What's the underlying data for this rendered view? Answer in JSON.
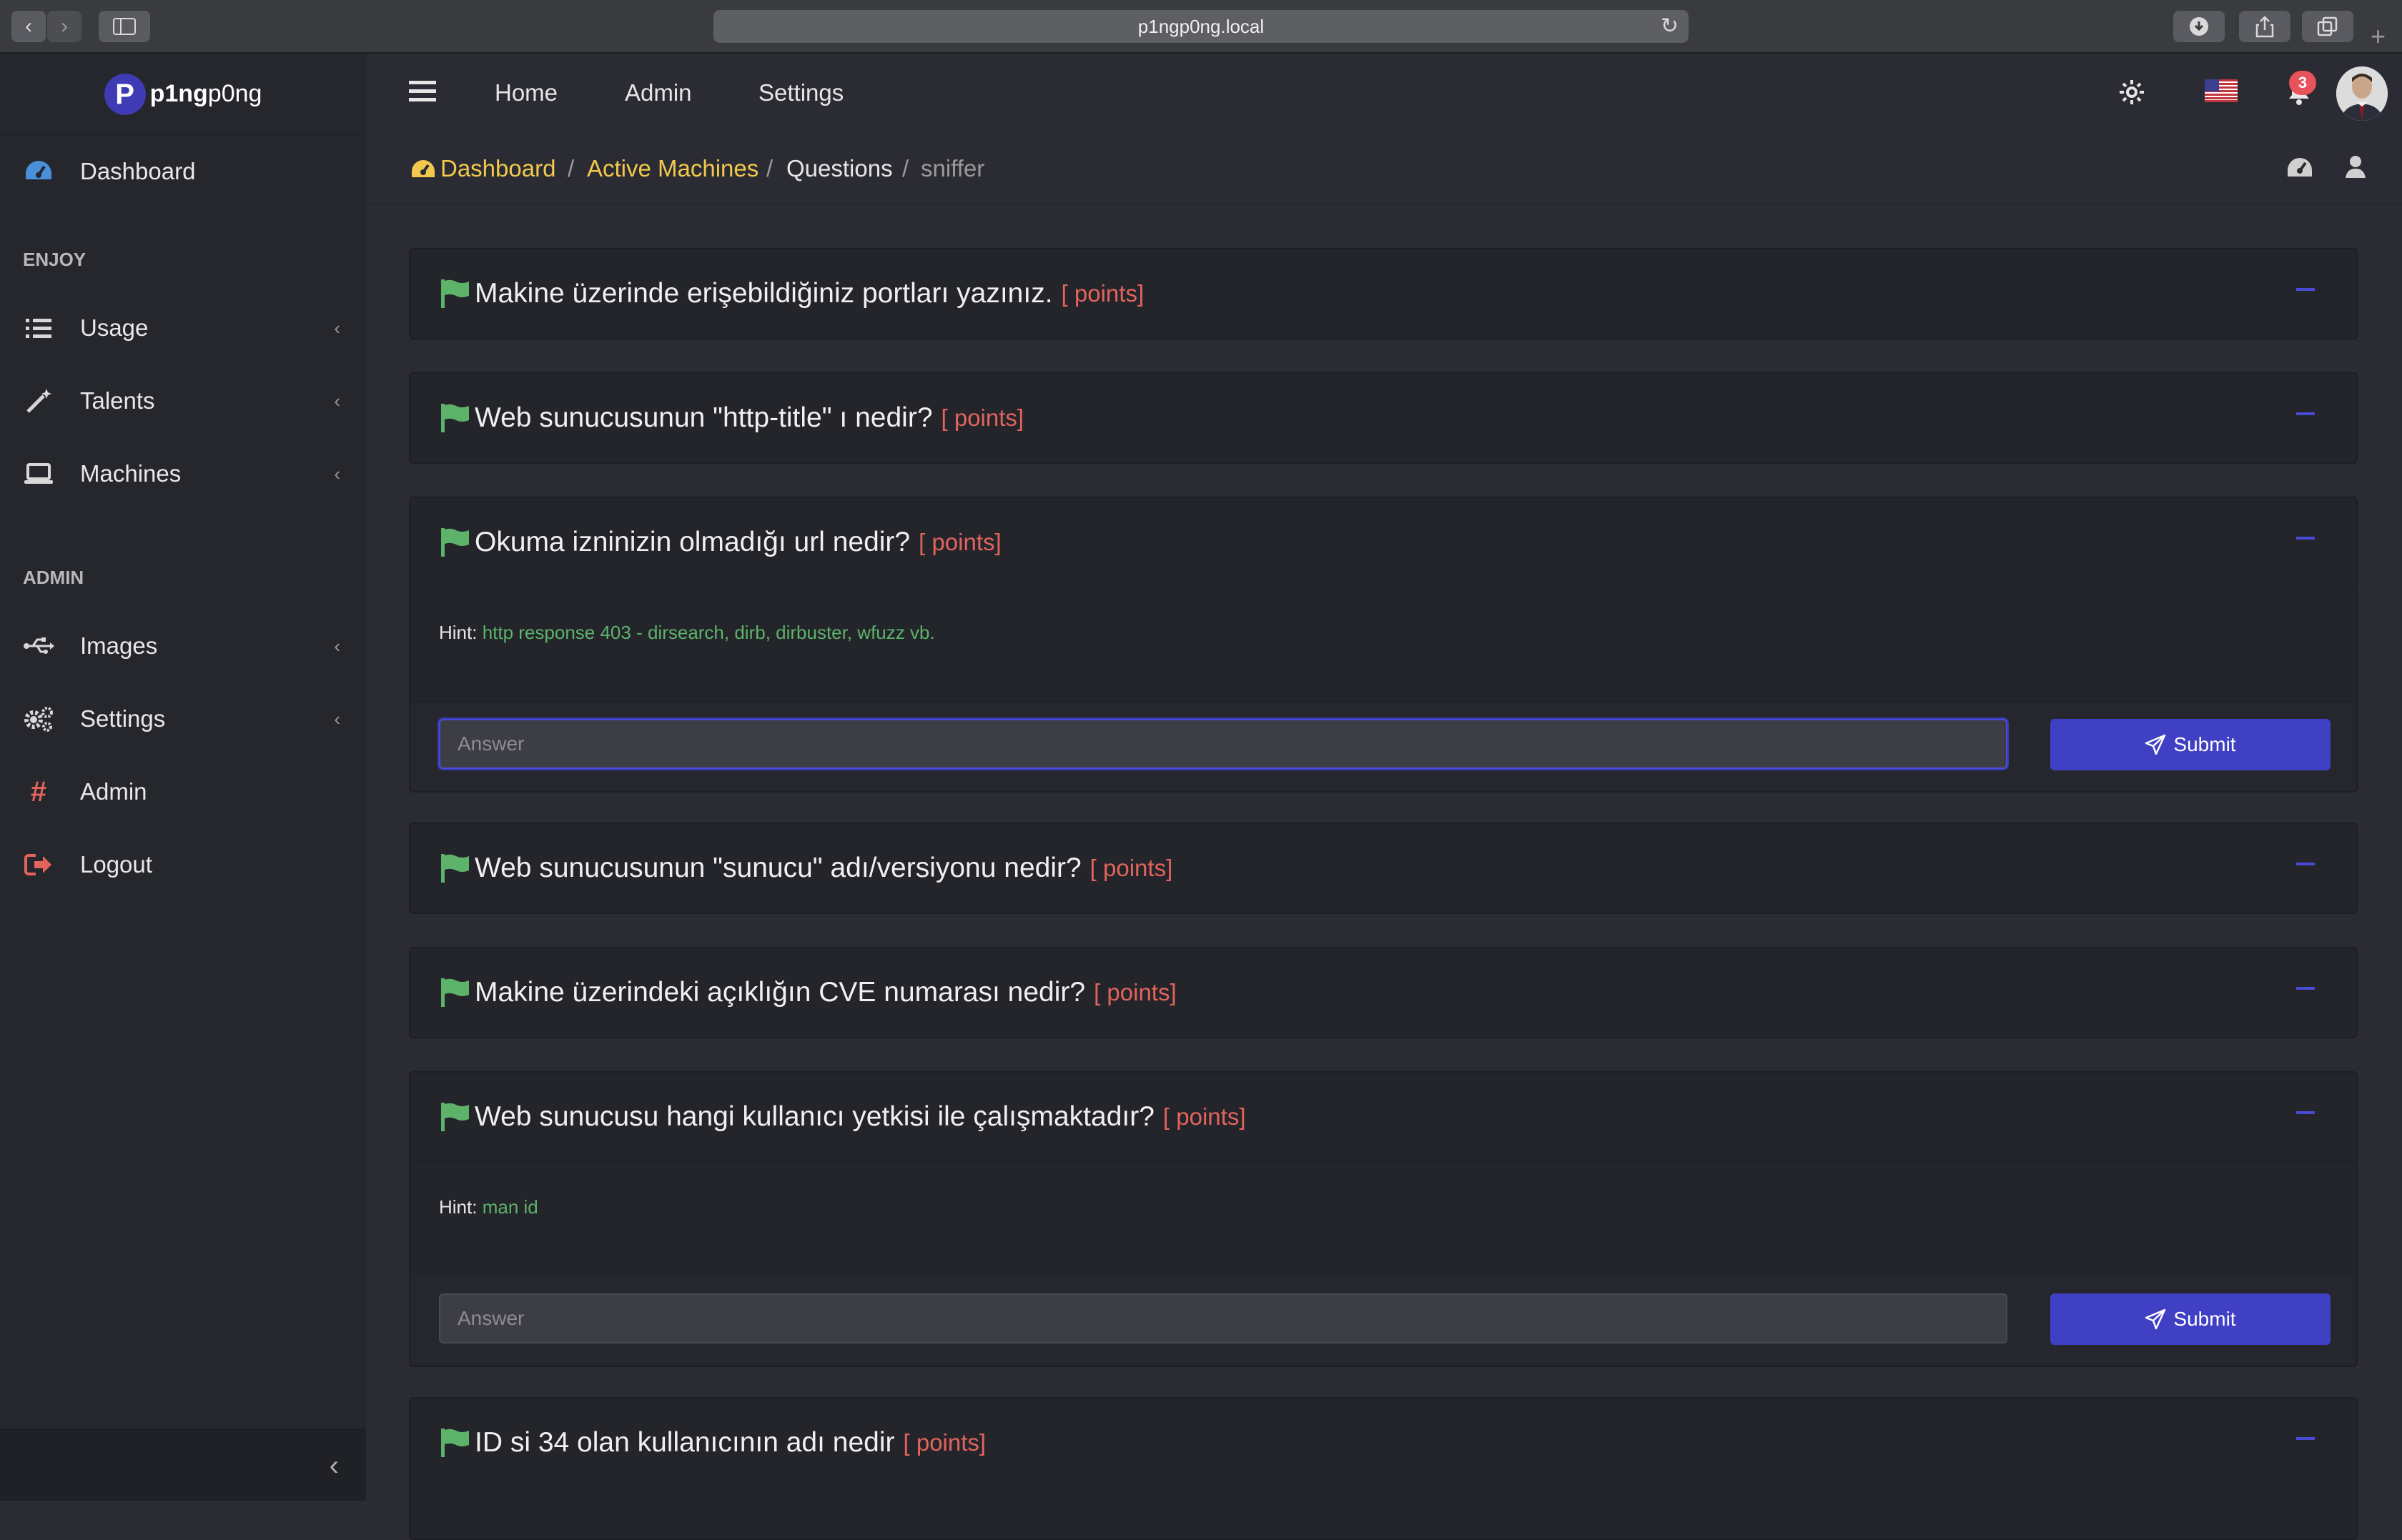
{
  "browser": {
    "url": "p1ngp0ng.local"
  },
  "brand": {
    "logo_letter": "P",
    "name_bold": "p1ng",
    "name_rest": "p0ng"
  },
  "sidebar": {
    "dashboard": "Dashboard",
    "section_enjoy": "ENJOY",
    "usage": "Usage",
    "talents": "Talents",
    "machines": "Machines",
    "section_admin": "ADMIN",
    "images": "Images",
    "settings": "Settings",
    "admin": "Admin",
    "logout": "Logout"
  },
  "topnav": {
    "home": "Home",
    "admin": "Admin",
    "settings": "Settings",
    "notification_count": "3"
  },
  "breadcrumb": {
    "dashboard": "Dashboard",
    "active_machines": "Active Machines",
    "questions": "Questions",
    "current": "sniffer",
    "separator": "/"
  },
  "questions": [
    {
      "title": "Makine üzerinde erişebildiğiniz portları yazınız.",
      "points": "[ points]"
    },
    {
      "title": "Web sunucusunun \"http-title\" ı nedir?",
      "points": "[ points]"
    },
    {
      "title": "Okuma izninizin olmadığı url nedir?",
      "points": "[ points]",
      "hint_label": "Hint:",
      "hint": "http response 403 - dirsearch, dirb, dirbuster, wfuzz vb.",
      "placeholder": "Answer",
      "submit": "Submit"
    },
    {
      "title": "Web sunucusunun \"sunucu\" adı/versiyonu nedir?",
      "points": "[ points]"
    },
    {
      "title": "Makine üzerindeki açıklığın CVE numarası nedir?",
      "points": "[ points]"
    },
    {
      "title": "Web sunucusu hangi kullanıcı yetkisi ile çalışmaktadır?",
      "points": "[ points]",
      "hint_label": "Hint:",
      "hint": "man id",
      "placeholder": "Answer",
      "submit": "Submit"
    },
    {
      "title": "ID si 34 olan kullanıcının adı nedir",
      "points": "[ points]"
    }
  ],
  "colors": {
    "accent": "#4040c4",
    "breadcrumb_link": "#f2c94c",
    "points": "#e2645c",
    "hint": "#5db36a",
    "flag": "#5db36a"
  }
}
